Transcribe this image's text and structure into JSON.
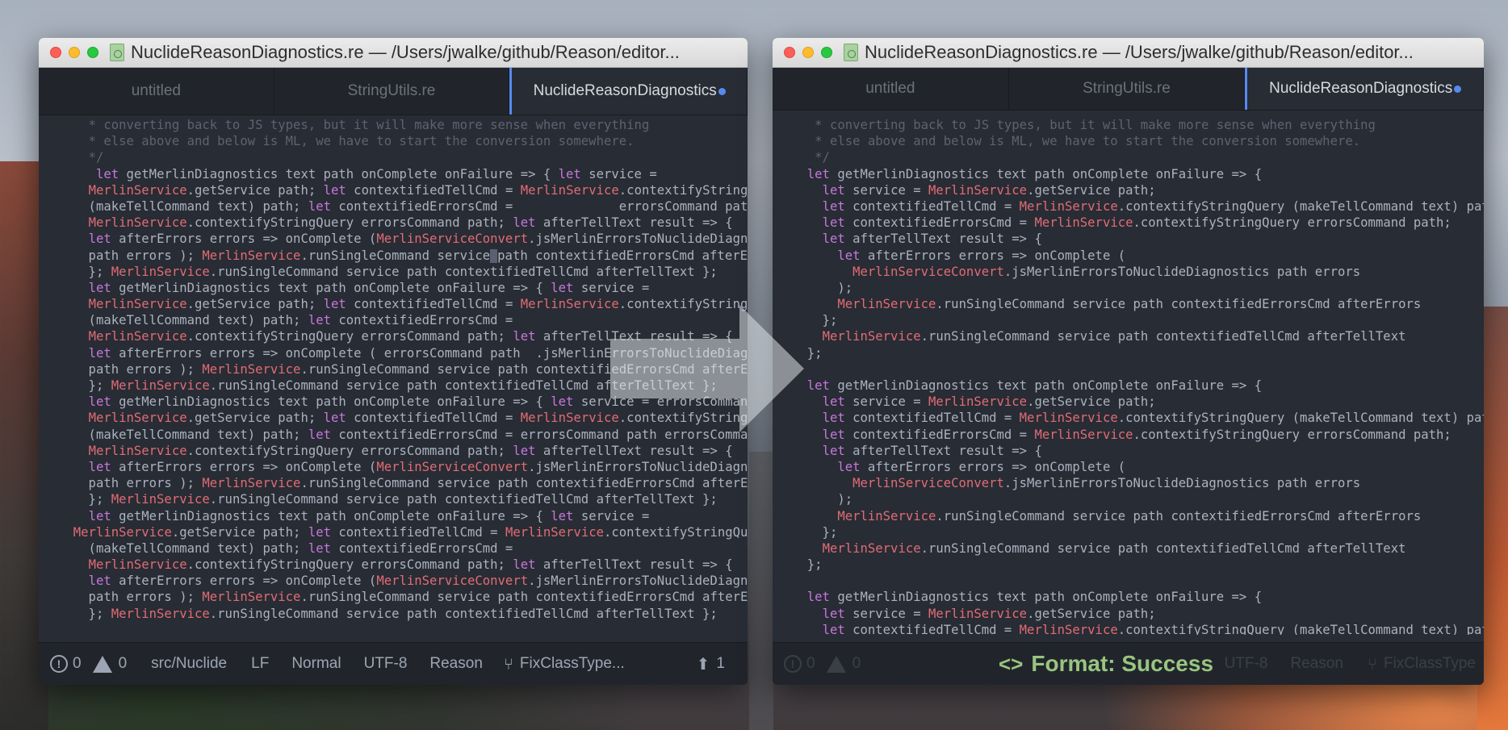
{
  "left_window": {
    "title": "NuclideReasonDiagnostics.re — /Users/jwalke/github/Reason/editor...",
    "tabs": [
      {
        "label": "untitled",
        "active": false
      },
      {
        "label": "StringUtils.re",
        "active": false
      },
      {
        "label": "NuclideReasonDiagnostics",
        "active": true,
        "modified": true
      }
    ],
    "code_lines": [
      [
        [
          "c",
          "    * converting back to JS types, but it will make more sense when everything"
        ]
      ],
      [
        [
          "c",
          "    * else above and below is ML, we have to start the conversion somewhere."
        ]
      ],
      [
        [
          "c",
          "    */"
        ]
      ],
      [
        [
          "t",
          "     "
        ],
        [
          "k",
          "let"
        ],
        [
          "t",
          " getMerlinDiagnostics text path onComplete onFailure => { "
        ],
        [
          "k",
          "let"
        ],
        [
          "t",
          " service ="
        ]
      ],
      [
        [
          "t",
          "    "
        ],
        [
          "r",
          "MerlinService"
        ],
        [
          "t",
          ".getService path; "
        ],
        [
          "k",
          "let"
        ],
        [
          "t",
          " contextifiedTellCmd = "
        ],
        [
          "r",
          "MerlinService"
        ],
        [
          "t",
          ".contextifyStringQuery"
        ]
      ],
      [
        [
          "t",
          "    (makeTellCommand text) path; "
        ],
        [
          "k",
          "let"
        ],
        [
          "t",
          " contextifiedErrorsCmd =              errorsCommand path"
        ]
      ],
      [
        [
          "t",
          "    "
        ],
        [
          "r",
          "MerlinService"
        ],
        [
          "t",
          ".contextifyStringQuery errorsCommand path; "
        ],
        [
          "k",
          "let"
        ],
        [
          "t",
          " afterTellText result => {"
        ]
      ],
      [
        [
          "t",
          "    "
        ],
        [
          "k",
          "let"
        ],
        [
          "t",
          " afterErrors errors => onComplete ("
        ],
        [
          "r",
          "MerlinServiceConvert"
        ],
        [
          "t",
          ".jsMerlinErrorsToNuclideDiagnostics"
        ]
      ],
      [
        [
          "t",
          "    path errors ); "
        ],
        [
          "r",
          "MerlinService"
        ],
        [
          "t",
          ".runSingleCommand service"
        ],
        [
          "cur",
          ""
        ],
        [
          "t",
          "path contextifiedErrorsCmd afterErrors"
        ]
      ],
      [
        [
          "t",
          "    }; "
        ],
        [
          "r",
          "MerlinService"
        ],
        [
          "t",
          ".runSingleCommand service path contextifiedTellCmd afterTellText };"
        ]
      ],
      [
        [
          "t",
          "    "
        ],
        [
          "k",
          "let"
        ],
        [
          "t",
          " getMerlinDiagnostics text path onComplete onFailure => { "
        ],
        [
          "k",
          "let"
        ],
        [
          "t",
          " service ="
        ]
      ],
      [
        [
          "t",
          "    "
        ],
        [
          "r",
          "MerlinService"
        ],
        [
          "t",
          ".getService path; "
        ],
        [
          "k",
          "let"
        ],
        [
          "t",
          " contextifiedTellCmd = "
        ],
        [
          "r",
          "MerlinService"
        ],
        [
          "t",
          ".contextifyStringQuery"
        ]
      ],
      [
        [
          "t",
          "    (makeTellCommand text) path; "
        ],
        [
          "k",
          "let"
        ],
        [
          "t",
          " contextifiedErrorsCmd ="
        ]
      ],
      [
        [
          "t",
          "    "
        ],
        [
          "r",
          "MerlinService"
        ],
        [
          "t",
          ".contextifyStringQuery errorsCommand path; "
        ],
        [
          "k",
          "let"
        ],
        [
          "t",
          " afterTellText result => {"
        ]
      ],
      [
        [
          "t",
          "    "
        ],
        [
          "k",
          "let"
        ],
        [
          "t",
          " afterErrors errors => onComplete ( errorsCommand path  .jsMerlinErrorsToNuclideDiagnostics"
        ]
      ],
      [
        [
          "t",
          "    path errors ); "
        ],
        [
          "r",
          "MerlinService"
        ],
        [
          "t",
          ".runSingleCommand service path contextifiedErrorsCmd afterErrors"
        ]
      ],
      [
        [
          "t",
          "    }; "
        ],
        [
          "r",
          "MerlinService"
        ],
        [
          "t",
          ".runSingleCommand service path contextifiedTellCmd afterTellText };"
        ]
      ],
      [
        [
          "t",
          "    "
        ],
        [
          "k",
          "let"
        ],
        [
          "t",
          " getMerlinDiagnostics text path onComplete onFailure => { "
        ],
        [
          "k",
          "let"
        ],
        [
          "t",
          " service = errorsCommand path"
        ]
      ],
      [
        [
          "t",
          "    "
        ],
        [
          "r",
          "MerlinService"
        ],
        [
          "t",
          ".getService path; "
        ],
        [
          "k",
          "let"
        ],
        [
          "t",
          " contextifiedTellCmd = "
        ],
        [
          "r",
          "MerlinService"
        ],
        [
          "t",
          ".contextifyStringQuery"
        ]
      ],
      [
        [
          "t",
          "    (makeTellCommand text) path; "
        ],
        [
          "k",
          "let"
        ],
        [
          "t",
          " contextifiedErrorsCmd = errorsCommand path errorsCommand path"
        ]
      ],
      [
        [
          "t",
          "    "
        ],
        [
          "r",
          "MerlinService"
        ],
        [
          "t",
          ".contextifyStringQuery errorsCommand path; "
        ],
        [
          "k",
          "let"
        ],
        [
          "t",
          " afterTellText result => {"
        ]
      ],
      [
        [
          "t",
          "    "
        ],
        [
          "k",
          "let"
        ],
        [
          "t",
          " afterErrors errors => onComplete ("
        ],
        [
          "r",
          "MerlinServiceConvert"
        ],
        [
          "t",
          ".jsMerlinErrorsToNuclideDiagnostics"
        ]
      ],
      [
        [
          "t",
          "    path errors ); "
        ],
        [
          "r",
          "MerlinService"
        ],
        [
          "t",
          ".runSingleCommand service path contextifiedErrorsCmd afterErrors"
        ]
      ],
      [
        [
          "t",
          "    }; "
        ],
        [
          "r",
          "MerlinService"
        ],
        [
          "t",
          ".runSingleCommand service path contextifiedTellCmd afterTellText };"
        ]
      ],
      [
        [
          "t",
          "    "
        ],
        [
          "k",
          "let"
        ],
        [
          "t",
          " getMerlinDiagnostics text path onComplete onFailure => { "
        ],
        [
          "k",
          "let"
        ],
        [
          "t",
          " service ="
        ]
      ],
      [
        [
          "t",
          "  "
        ],
        [
          "r",
          "MerlinService"
        ],
        [
          "t",
          ".getService path; "
        ],
        [
          "k",
          "let"
        ],
        [
          "t",
          " contextifiedTellCmd = "
        ],
        [
          "r",
          "MerlinService"
        ],
        [
          "t",
          ".contextifyStringQuery"
        ]
      ],
      [
        [
          "t",
          "    (makeTellCommand text) path; "
        ],
        [
          "k",
          "let"
        ],
        [
          "t",
          " contextifiedErrorsCmd ="
        ]
      ],
      [
        [
          "t",
          "    "
        ],
        [
          "r",
          "MerlinService"
        ],
        [
          "t",
          ".contextifyStringQuery errorsCommand path; "
        ],
        [
          "k",
          "let"
        ],
        [
          "t",
          " afterTellText result => {"
        ]
      ],
      [
        [
          "t",
          "    "
        ],
        [
          "k",
          "let"
        ],
        [
          "t",
          " afterErrors errors => onComplete ("
        ],
        [
          "r",
          "MerlinServiceConvert"
        ],
        [
          "t",
          ".jsMerlinErrorsToNuclideDiagnostics"
        ]
      ],
      [
        [
          "t",
          "    path errors ); "
        ],
        [
          "r",
          "MerlinService"
        ],
        [
          "t",
          ".runSingleCommand service path contextifiedErrorsCmd afterErrors"
        ]
      ],
      [
        [
          "t",
          "    }; "
        ],
        [
          "r",
          "MerlinService"
        ],
        [
          "t",
          ".runSingleCommand service path contextifiedTellCmd afterTellText };"
        ]
      ]
    ],
    "status": {
      "errors": "0",
      "warnings": "0",
      "path": "src/Nuclide",
      "line_ending": "LF",
      "mode": "Normal",
      "encoding": "UTF-8",
      "grammar": "Reason",
      "branch": "FixClassType...",
      "ahead": "1"
    }
  },
  "right_window": {
    "title": "NuclideReasonDiagnostics.re — /Users/jwalke/github/Reason/editor...",
    "tabs": [
      {
        "label": "untitled",
        "active": false
      },
      {
        "label": "StringUtils.re",
        "active": false
      },
      {
        "label": "NuclideReasonDiagnostics",
        "active": true,
        "modified": true
      }
    ],
    "code_lines": [
      [
        [
          "c",
          "   * converting back to JS types, but it will make more sense when everything"
        ]
      ],
      [
        [
          "c",
          "   * else above and below is ML, we have to start the conversion somewhere."
        ]
      ],
      [
        [
          "c",
          "   */"
        ]
      ],
      [
        [
          "t",
          "  "
        ],
        [
          "k",
          "let"
        ],
        [
          "t",
          " getMerlinDiagnostics text path onComplete onFailure => {"
        ]
      ],
      [
        [
          "t",
          "    "
        ],
        [
          "k",
          "let"
        ],
        [
          "t",
          " service = "
        ],
        [
          "r",
          "MerlinService"
        ],
        [
          "t",
          ".getService path;"
        ]
      ],
      [
        [
          "t",
          "    "
        ],
        [
          "k",
          "let"
        ],
        [
          "t",
          " contextifiedTellCmd = "
        ],
        [
          "r",
          "MerlinService"
        ],
        [
          "t",
          ".contextifyStringQuery (makeTellCommand text) path;"
        ]
      ],
      [
        [
          "t",
          "    "
        ],
        [
          "k",
          "let"
        ],
        [
          "t",
          " contextifiedErrorsCmd = "
        ],
        [
          "r",
          "MerlinService"
        ],
        [
          "t",
          ".contextifyStringQuery errorsCommand path;"
        ]
      ],
      [
        [
          "t",
          "    "
        ],
        [
          "k",
          "let"
        ],
        [
          "t",
          " afterTellText result => {"
        ]
      ],
      [
        [
          "t",
          "      "
        ],
        [
          "k",
          "let"
        ],
        [
          "t",
          " afterErrors errors => onComplete ("
        ]
      ],
      [
        [
          "t",
          "        "
        ],
        [
          "r",
          "MerlinServiceConvert"
        ],
        [
          "t",
          ".jsMerlinErrorsToNuclideDiagnostics path errors"
        ]
      ],
      [
        [
          "t",
          "      );"
        ]
      ],
      [
        [
          "t",
          "      "
        ],
        [
          "r",
          "MerlinService"
        ],
        [
          "t",
          ".runSingleCommand service path contextifiedErrorsCmd afterErrors"
        ]
      ],
      [
        [
          "t",
          "    };"
        ]
      ],
      [
        [
          "t",
          "    "
        ],
        [
          "r",
          "MerlinService"
        ],
        [
          "t",
          ".runSingleCommand service path contextifiedTellCmd afterTellText"
        ]
      ],
      [
        [
          "t",
          "  };"
        ]
      ],
      [
        [
          "t",
          ""
        ]
      ],
      [
        [
          "t",
          "  "
        ],
        [
          "k",
          "let"
        ],
        [
          "t",
          " getMerlinDiagnostics text path onComplete onFailure => {"
        ]
      ],
      [
        [
          "t",
          "    "
        ],
        [
          "k",
          "let"
        ],
        [
          "t",
          " service = "
        ],
        [
          "r",
          "MerlinService"
        ],
        [
          "t",
          ".getService path;"
        ]
      ],
      [
        [
          "t",
          "    "
        ],
        [
          "k",
          "let"
        ],
        [
          "t",
          " contextifiedTellCmd = "
        ],
        [
          "r",
          "MerlinService"
        ],
        [
          "t",
          ".contextifyStringQuery (makeTellCommand text) path;"
        ]
      ],
      [
        [
          "t",
          "    "
        ],
        [
          "k",
          "let"
        ],
        [
          "t",
          " contextifiedErrorsCmd = "
        ],
        [
          "r",
          "MerlinService"
        ],
        [
          "t",
          ".contextifyStringQuery errorsCommand path;"
        ]
      ],
      [
        [
          "t",
          "    "
        ],
        [
          "k",
          "let"
        ],
        [
          "t",
          " afterTellText result => {"
        ]
      ],
      [
        [
          "t",
          "      "
        ],
        [
          "k",
          "let"
        ],
        [
          "t",
          " afterErrors errors => onComplete ("
        ]
      ],
      [
        [
          "t",
          "        "
        ],
        [
          "r",
          "MerlinServiceConvert"
        ],
        [
          "t",
          ".jsMerlinErrorsToNuclideDiagnostics path errors"
        ]
      ],
      [
        [
          "t",
          "      );"
        ]
      ],
      [
        [
          "t",
          "      "
        ],
        [
          "r",
          "MerlinService"
        ],
        [
          "t",
          ".runSingleCommand service path contextifiedErrorsCmd afterErrors"
        ]
      ],
      [
        [
          "t",
          "    };"
        ]
      ],
      [
        [
          "t",
          "    "
        ],
        [
          "r",
          "MerlinService"
        ],
        [
          "t",
          ".runSingleCommand service path contextifiedTellCmd afterTellText"
        ]
      ],
      [
        [
          "t",
          "  };"
        ]
      ],
      [
        [
          "t",
          ""
        ]
      ],
      [
        [
          "t",
          "  "
        ],
        [
          "k",
          "let"
        ],
        [
          "t",
          " getMerlinDiagnostics text path onComplete onFailure => {"
        ]
      ],
      [
        [
          "t",
          "    "
        ],
        [
          "k",
          "let"
        ],
        [
          "t",
          " service = "
        ],
        [
          "r",
          "MerlinService"
        ],
        [
          "t",
          ".getService path;"
        ]
      ],
      [
        [
          "t",
          "    "
        ],
        [
          "k",
          "let"
        ],
        [
          "t",
          " contextifiedTellCmd = "
        ],
        [
          "r",
          "MerlinService"
        ],
        [
          "t",
          ".contextifyStringQuery (makeTellCommand text) path;"
        ]
      ]
    ],
    "status": {
      "errors": "0",
      "warnings": "0",
      "encoding": "UTF-8",
      "grammar": "Reason",
      "branch": "FixClassType"
    },
    "toast": {
      "icon": "<>",
      "text": "Format: Success"
    }
  },
  "colors": {
    "keyword": "#c678dd",
    "module": "#e06c75",
    "comment": "#5c6370",
    "text": "#abb2bf",
    "accent": "#568af2",
    "success": "#99c580"
  }
}
